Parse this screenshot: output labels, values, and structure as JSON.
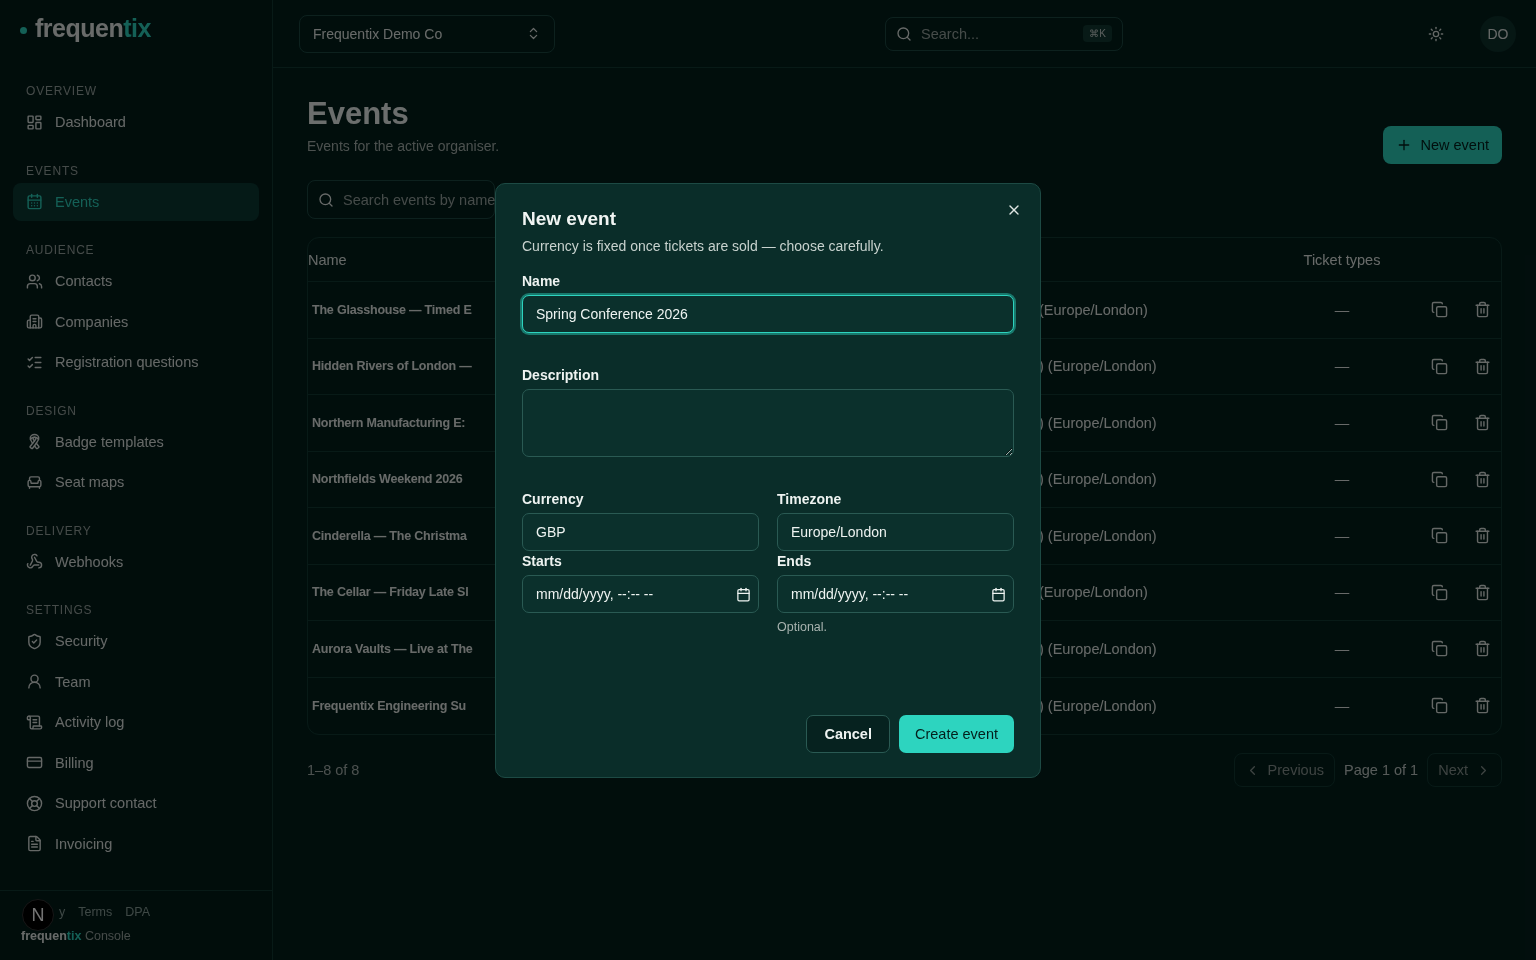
{
  "brand": {
    "main": "frequen",
    "accent": "tix"
  },
  "sidebar": {
    "sections": [
      {
        "heading": "OVERVIEW",
        "items": [
          {
            "label": "Dashboard",
            "selected": false
          }
        ]
      },
      {
        "heading": "EVENTS",
        "items": [
          {
            "label": "Events",
            "selected": true
          }
        ]
      },
      {
        "heading": "AUDIENCE",
        "items": [
          {
            "label": "Contacts",
            "selected": false
          },
          {
            "label": "Companies",
            "selected": false
          },
          {
            "label": "Registration questions",
            "selected": false
          }
        ]
      },
      {
        "heading": "DESIGN",
        "items": [
          {
            "label": "Badge templates",
            "selected": false
          },
          {
            "label": "Seat maps",
            "selected": false
          }
        ]
      },
      {
        "heading": "DELIVERY",
        "items": [
          {
            "label": "Webhooks",
            "selected": false
          }
        ]
      },
      {
        "heading": "SETTINGS",
        "items": [
          {
            "label": "Security",
            "selected": false
          },
          {
            "label": "Team",
            "selected": false
          },
          {
            "label": "Activity log",
            "selected": false
          },
          {
            "label": "Billing",
            "selected": false
          },
          {
            "label": "Support contact",
            "selected": false
          },
          {
            "label": "Invoicing",
            "selected": false
          }
        ]
      }
    ],
    "footer_links": [
      "y",
      "Terms",
      "DPA"
    ],
    "footer_brand": {
      "main": "frequen",
      "accent": "tix",
      "suffix": "Console"
    },
    "dev_badge": "N"
  },
  "topbar": {
    "organisation": "Frequentix Demo Co",
    "search": {
      "placeholder": "Search...",
      "shortcut": "⌘K"
    },
    "avatar": "DO"
  },
  "page": {
    "title": "Events",
    "subtitle": "Events for the active organiser.",
    "new_button": "New event",
    "search": {
      "placeholder": "Search events by name"
    }
  },
  "table": {
    "columns": [
      "Name",
      "Ticket types"
    ],
    "rows": [
      {
        "name": "The Glasshouse — Timed E",
        "when": "(Europe/London)",
        "ticket_types": "—"
      },
      {
        "name": "Hidden Rivers of London —",
        "when": ") (Europe/London)",
        "ticket_types": "—"
      },
      {
        "name": "Northern Manufacturing E:",
        "when": ") (Europe/London)",
        "ticket_types": "—"
      },
      {
        "name": "Northfields Weekend 2026",
        "when": ") (Europe/London)",
        "ticket_types": "—"
      },
      {
        "name": "Cinderella — The Christma",
        "when": ") (Europe/London)",
        "ticket_types": "—"
      },
      {
        "name": "The Cellar — Friday Late Sl",
        "when": "(Europe/London)",
        "ticket_types": "—"
      },
      {
        "name": "Aurora Vaults — Live at The",
        "when": ") (Europe/London)",
        "ticket_types": "—"
      },
      {
        "name": "Frequentix Engineering Su",
        "when": ") (Europe/London)",
        "ticket_types": "—"
      }
    ]
  },
  "pagination": {
    "summary": "1–8 of 8",
    "previous": "Previous",
    "page": "Page 1 of 1",
    "next": "Next"
  },
  "dialog": {
    "title": "New event",
    "description": "Currency is fixed once tickets are sold — choose carefully.",
    "name": {
      "label": "Name",
      "value": "Spring Conference 2026",
      "focused": true
    },
    "description_field": {
      "label": "Description"
    },
    "currency": {
      "label": "Currency",
      "value": "GBP"
    },
    "timezone": {
      "label": "Timezone",
      "value": "Europe/London"
    },
    "starts": {
      "label": "Starts",
      "placeholder": "mm/dd/yyyy, --:-- --"
    },
    "ends": {
      "label": "Ends",
      "placeholder": "mm/dd/yyyy, --:-- --",
      "hint": "Optional."
    },
    "cancel": "Cancel",
    "submit": "Create event"
  }
}
